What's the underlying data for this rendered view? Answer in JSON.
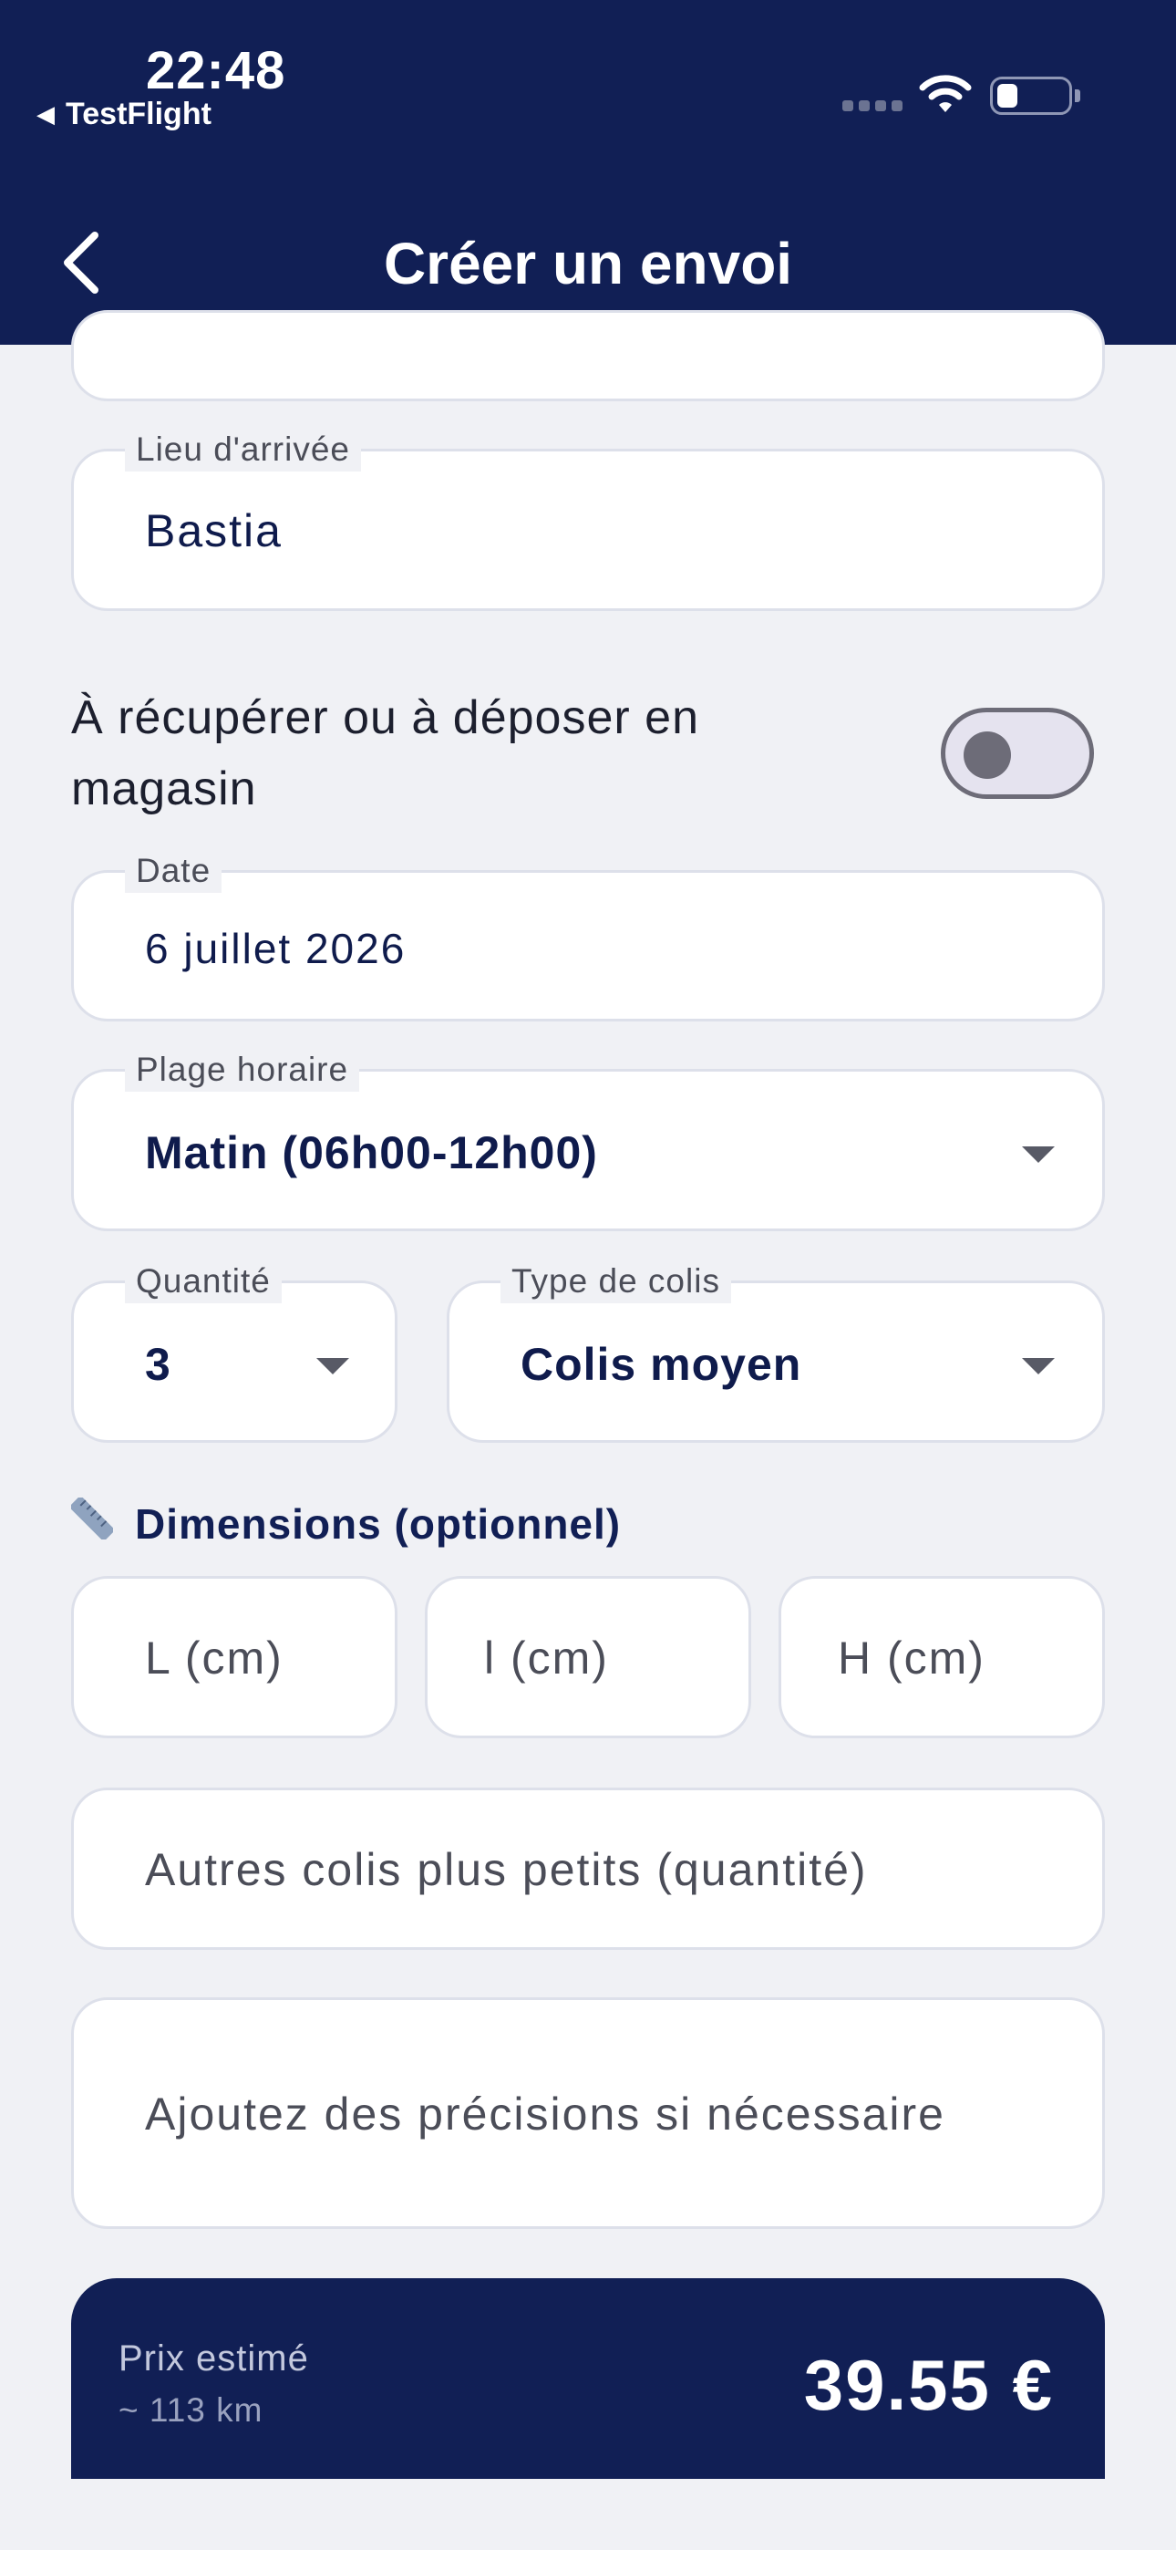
{
  "status_bar": {
    "time": "22:48",
    "back_app": "TestFlight"
  },
  "nav": {
    "title": "Créer un envoi",
    "back_icon": "chevron-left-icon"
  },
  "form": {
    "arrival": {
      "label": "Lieu d'arrivée",
      "value": "Bastia"
    },
    "pickup_toggle": {
      "label": "À récupérer ou à déposer en magasin",
      "on": false
    },
    "date": {
      "label": "Date",
      "value": "6 juillet 2026"
    },
    "time_slot": {
      "label": "Plage horaire",
      "value": "Matin (06h00-12h00)"
    },
    "quantity": {
      "label": "Quantité",
      "value": "3"
    },
    "parcel_type": {
      "label": "Type de colis",
      "value": "Colis moyen"
    },
    "dimensions": {
      "title": "Dimensions (optionnel)",
      "length_placeholder": "L (cm)",
      "width_placeholder": "l (cm)",
      "height_placeholder": "H (cm)"
    },
    "other_parcels_placeholder": "Autres colis plus petits (quantité)",
    "notes_placeholder": "Ajoutez des précisions si nécessaire"
  },
  "price": {
    "label": "Prix estimé",
    "distance": "~ 113 km",
    "value": "39.55 €"
  }
}
